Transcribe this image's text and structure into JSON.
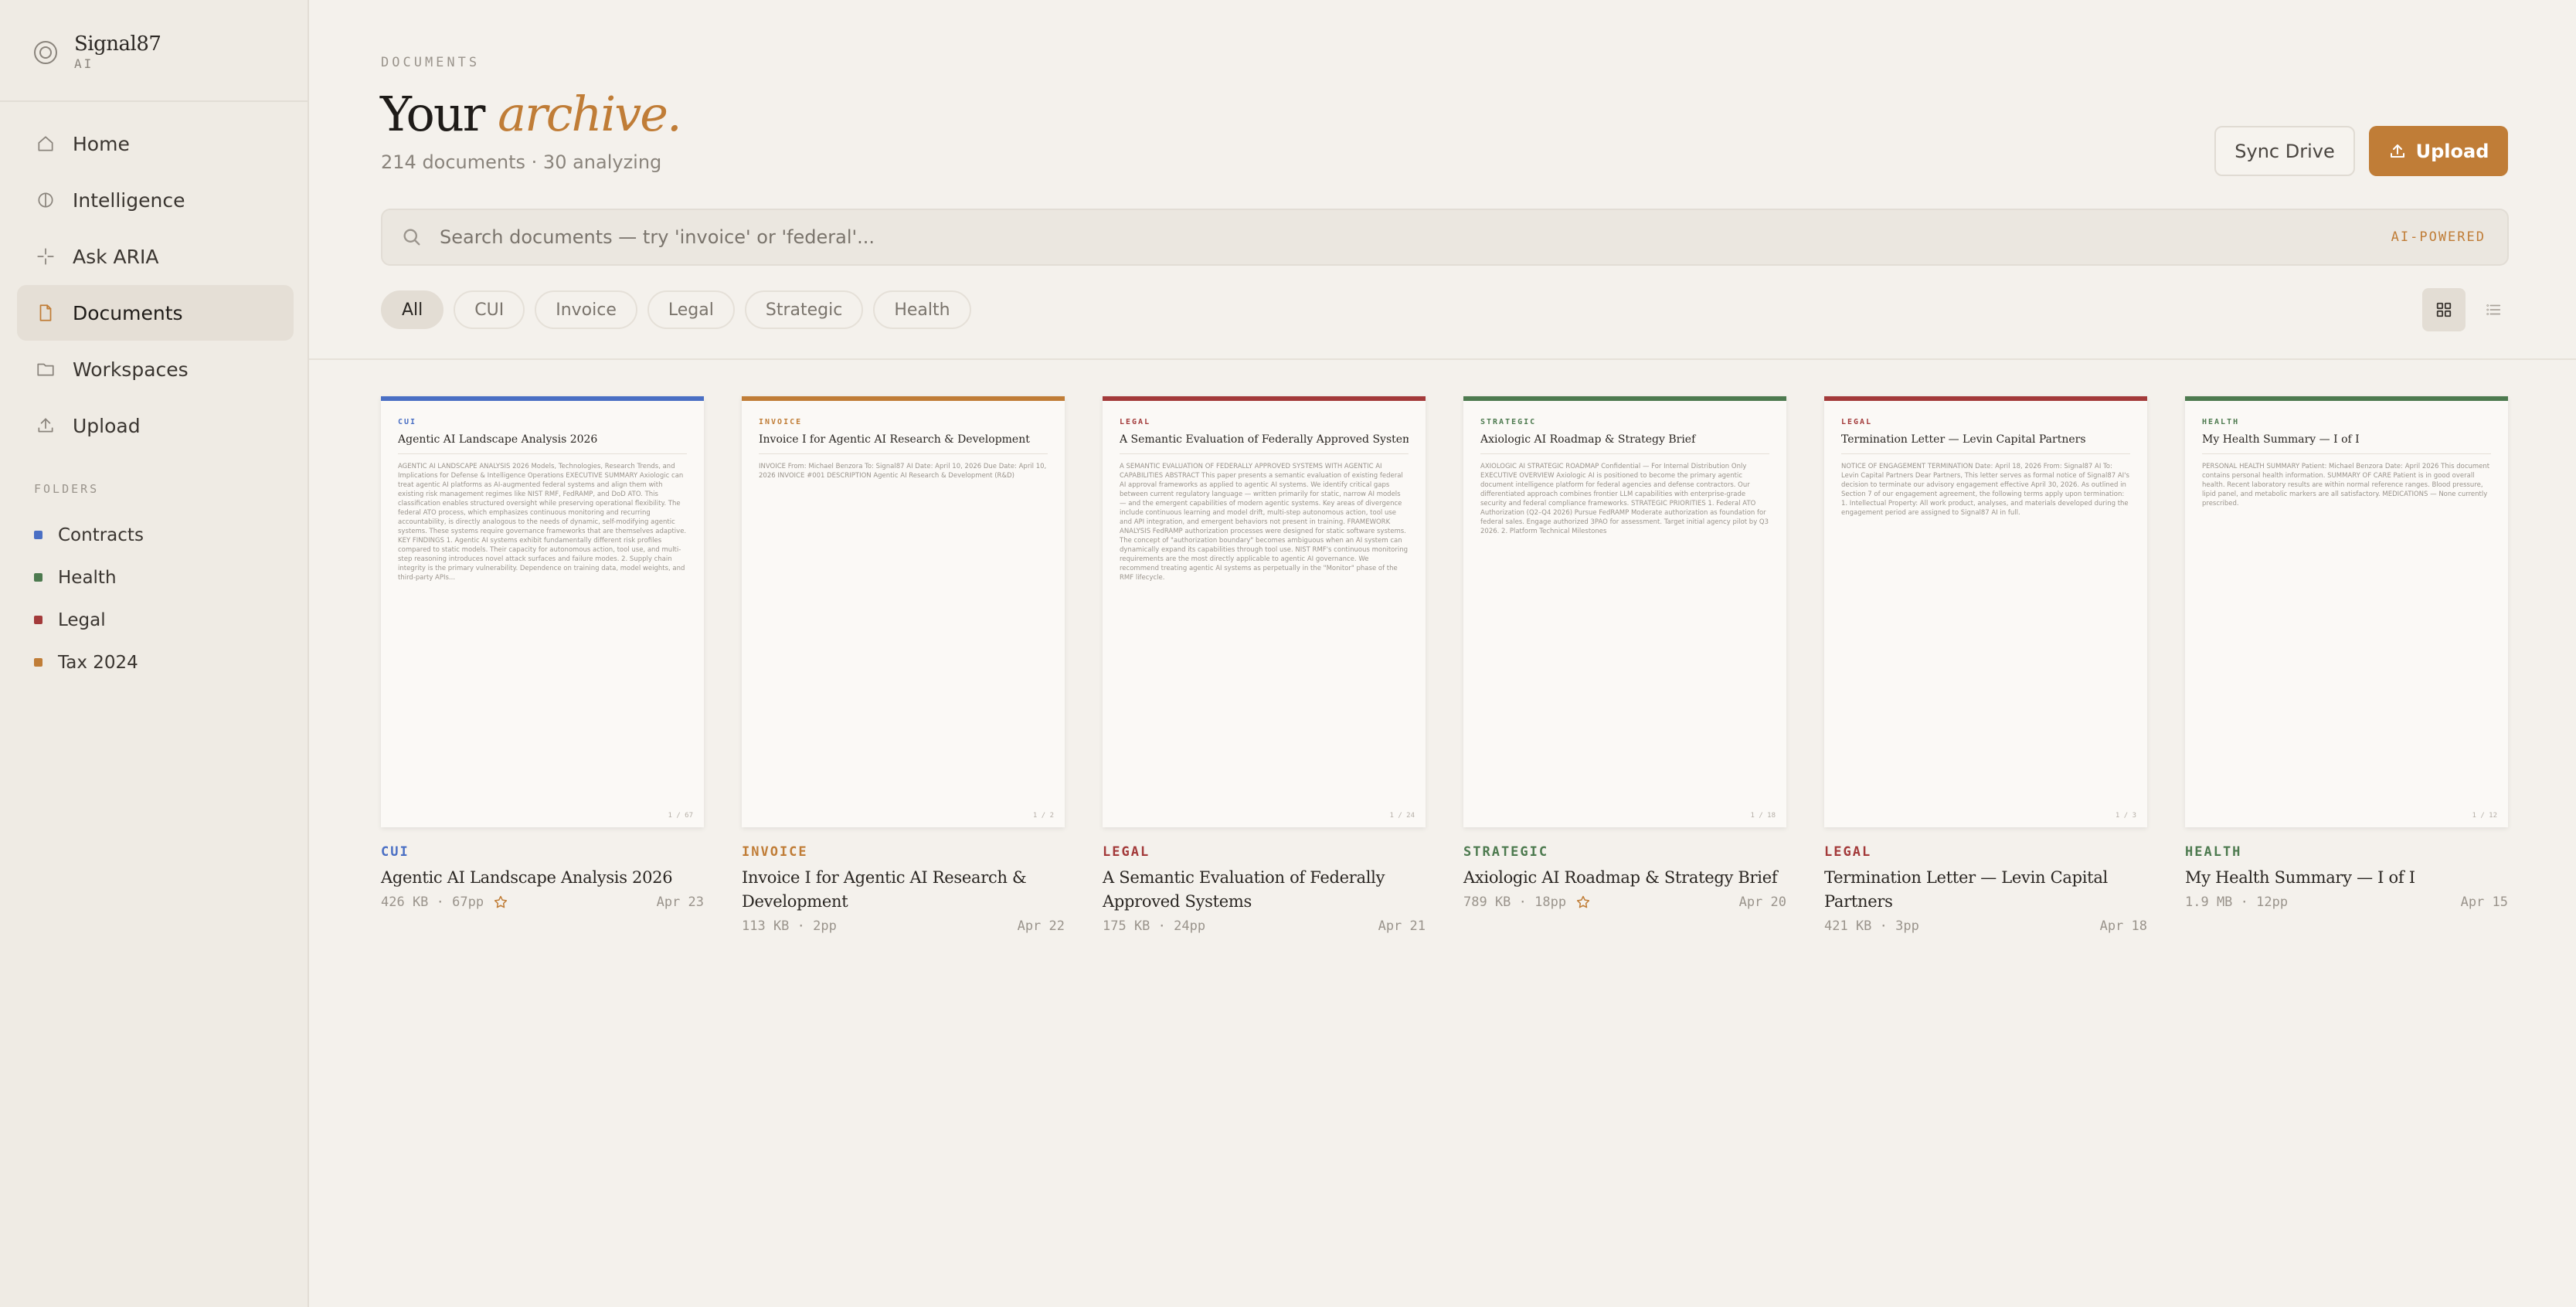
{
  "brand": {
    "name": "Signal87",
    "sub": "AI"
  },
  "nav": [
    {
      "label": "Home",
      "icon": "home-icon",
      "active": false
    },
    {
      "label": "Intelligence",
      "icon": "intelligence-icon",
      "active": false
    },
    {
      "label": "Ask ARIA",
      "icon": "sparkle-icon",
      "active": false
    },
    {
      "label": "Documents",
      "icon": "document-icon",
      "active": true
    },
    {
      "label": "Workspaces",
      "icon": "folder-icon",
      "active": false
    },
    {
      "label": "Upload",
      "icon": "upload-icon",
      "active": false
    }
  ],
  "folders_label": "FOLDERS",
  "folders": [
    {
      "label": "Contracts",
      "color": "#4a6fc4"
    },
    {
      "label": "Health",
      "color": "#4d7a4f"
    },
    {
      "label": "Legal",
      "color": "#a33a3a"
    },
    {
      "label": "Tax 2024",
      "color": "#c07d37"
    }
  ],
  "header": {
    "eyebrow": "DOCUMENTS",
    "title_plain": "Your",
    "title_accent": "archive.",
    "subtitle": "214 documents · 30 analyzing",
    "sync_label": "Sync Drive",
    "upload_label": "Upload"
  },
  "search": {
    "placeholder": "Search documents — try 'invoice' or 'federal'...",
    "badge": "AI-POWERED"
  },
  "filters": [
    {
      "label": "All",
      "active": true
    },
    {
      "label": "CUI",
      "active": false
    },
    {
      "label": "Invoice",
      "active": false
    },
    {
      "label": "Legal",
      "active": false
    },
    {
      "label": "Strategic",
      "active": false
    },
    {
      "label": "Health",
      "active": false
    }
  ],
  "view_mode": "grid",
  "documents": [
    {
      "tag": "CUI",
      "tag_color": "#4a6fc4",
      "thumb_tag": "CUI",
      "title": "Agentic AI Landscape Analysis 2026",
      "excerpt": "AGENTIC AI LANDSCAPE ANALYSIS 2026 Models, Technologies, Research Trends, and Implications for Defense & Intelligence Operations EXECUTIVE SUMMARY Axiologic can treat agentic AI platforms as AI-augmented federal systems and align them with existing risk management regimes like NIST RMF, FedRAMP, and DoD ATO. This classification enables structured oversight while preserving operational flexibility. The federal ATO process, which emphasizes continuous monitoring and recurring accountability, is directly analogous to the needs of dynamic, self-modifying agentic systems. These systems require governance frameworks that are themselves adaptive. KEY FINDINGS 1. Agentic AI systems exhibit fundamentally different risk profiles compared to static models. Their capacity for autonomous action, tool use, and multi-step reasoning introduces novel attack surfaces and failure modes. 2. Supply chain integrity is the primary vulnerability. Dependence on training data, model weights, and third-party APIs...",
      "page": "1 / 67",
      "meta": "426 KB · 67pp",
      "starred": true,
      "date": "Apr 23"
    },
    {
      "tag": "INVOICE",
      "tag_color": "#c07d37",
      "thumb_tag": "INVOICE",
      "title": "Invoice I for Agentic AI Research & Development",
      "excerpt": "INVOICE From: Michael Benzora To: Signal87 AI Date: April 10, 2026 Due Date: April 10, 2026 INVOICE #001 DESCRIPTION Agentic AI Research & Development (R&D)",
      "page": "1 / 2",
      "meta": "113 KB · 2pp",
      "starred": false,
      "date": "Apr 22"
    },
    {
      "tag": "LEGAL",
      "tag_color": "#a33a3a",
      "thumb_tag": "LEGAL",
      "title": "A Semantic Evaluation of Federally Approved Systems",
      "excerpt": "A SEMANTIC EVALUATION OF FEDERALLY APPROVED SYSTEMS WITH AGENTIC AI CAPABILITIES ABSTRACT This paper presents a semantic evaluation of existing federal AI approval frameworks as applied to agentic AI systems. We identify critical gaps between current regulatory language — written primarily for static, narrow AI models — and the emergent capabilities of modern agentic systems. Key areas of divergence include continuous learning and model drift, multi-step autonomous action, tool use and API integration, and emergent behaviors not present in training. FRAMEWORK ANALYSIS FedRAMP authorization processes were designed for static software systems. The concept of \"authorization boundary\" becomes ambiguous when an AI system can dynamically expand its capabilities through tool use. NIST RMF's continuous monitoring requirements are the most directly applicable to agentic AI governance. We recommend treating agentic AI systems as perpetually in the \"Monitor\" phase of the RMF lifecycle.",
      "page": "1 / 24",
      "meta": "175 KB · 24pp",
      "starred": false,
      "date": "Apr 21"
    },
    {
      "tag": "STRATEGIC",
      "tag_color": "#4d7a4f",
      "thumb_tag": "STRATEGIC",
      "title": "Axiologic AI Roadmap & Strategy Brief",
      "excerpt": "AXIOLOGIC AI STRATEGIC ROADMAP Confidential — For Internal Distribution Only EXECUTIVE OVERVIEW Axiologic AI is positioned to become the primary agentic document intelligence platform for federal agencies and defense contractors. Our differentiated approach combines frontier LLM capabilities with enterprise-grade security and federal compliance frameworks. STRATEGIC PRIORITIES 1. Federal ATO Authorization (Q2–Q4 2026) Pursue FedRAMP Moderate authorization as foundation for federal sales. Engage authorized 3PAO for assessment. Target initial agency pilot by Q3 2026. 2. Platform Technical Milestones",
      "page": "1 / 18",
      "meta": "789 KB · 18pp",
      "starred": true,
      "date": "Apr 20"
    },
    {
      "tag": "LEGAL",
      "tag_color": "#a33a3a",
      "thumb_tag": "LEGAL",
      "title": "Termination Letter — Levin Capital Partners",
      "excerpt": "NOTICE OF ENGAGEMENT TERMINATION Date: April 18, 2026 From: Signal87 AI To: Levin Capital Partners Dear Partners, This letter serves as formal notice of Signal87 AI's decision to terminate our advisory engagement effective April 30, 2026. As outlined in Section 7 of our engagement agreement, the following terms apply upon termination: 1. Intellectual Property: All work product, analyses, and materials developed during the engagement period are assigned to Signal87 AI in full.",
      "page": "1 / 3",
      "meta": "421 KB · 3pp",
      "starred": false,
      "date": "Apr 18"
    },
    {
      "tag": "HEALTH",
      "tag_color": "#4d7a4f",
      "thumb_tag": "HEALTH",
      "title": "My Health Summary — I of I",
      "excerpt": "PERSONAL HEALTH SUMMARY Patient: Michael Benzora Date: April 2026 This document contains personal health information. SUMMARY OF CARE Patient is in good overall health. Recent laboratory results are within normal reference ranges. Blood pressure, lipid panel, and metabolic markers are all satisfactory. MEDICATIONS — None currently prescribed.",
      "page": "1 / 12",
      "meta": "1.9 MB · 12pp",
      "starred": false,
      "date": "Apr 15"
    }
  ]
}
